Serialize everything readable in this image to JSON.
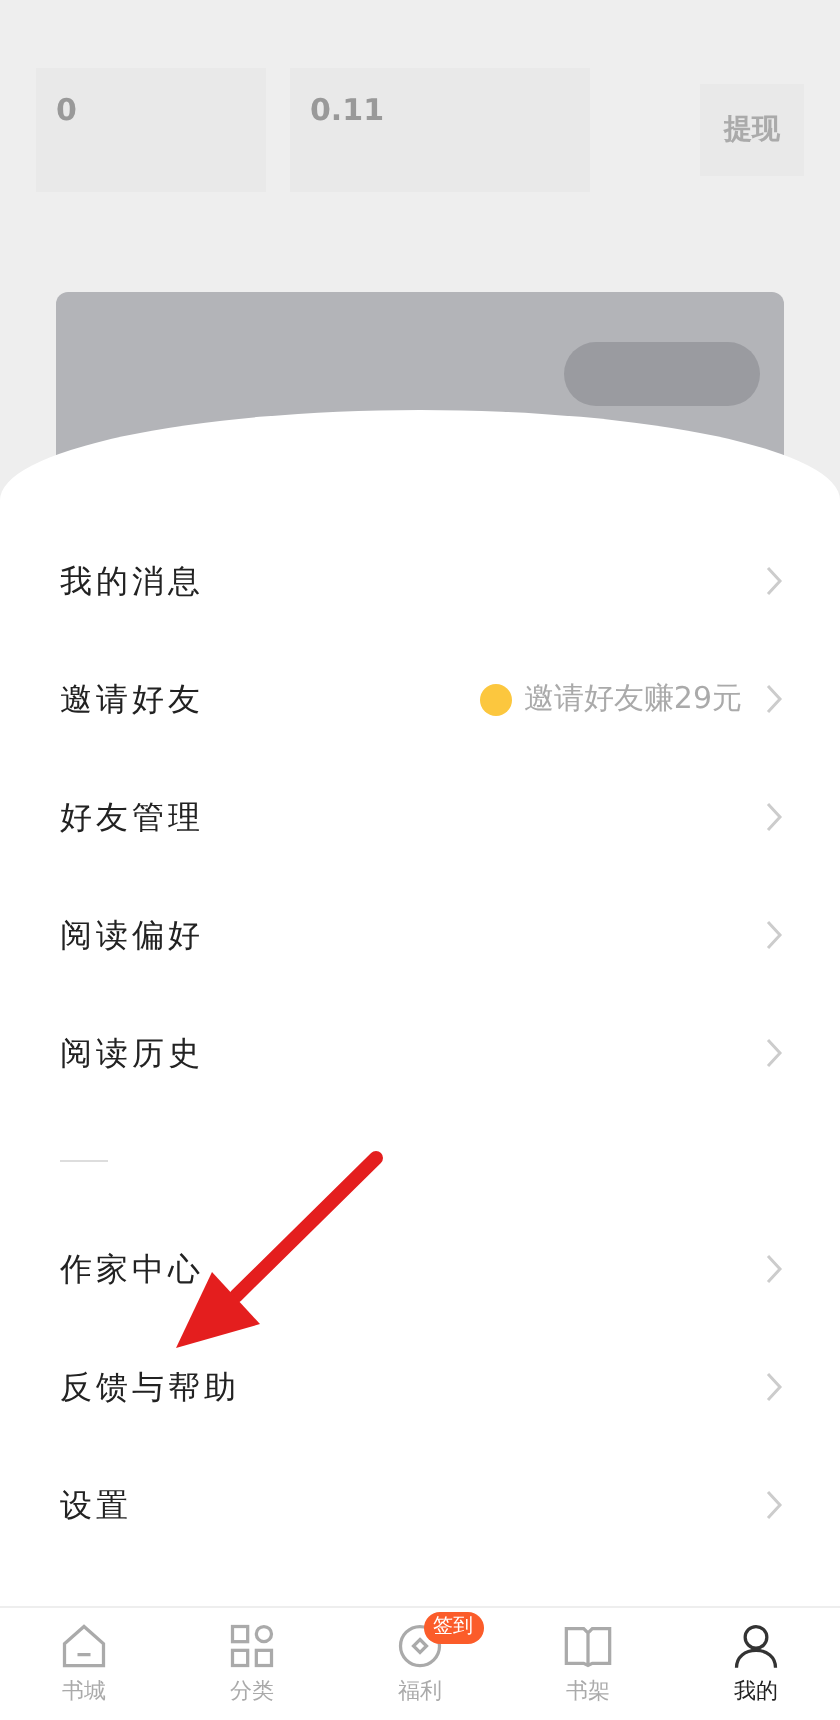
{
  "header": {
    "coins": "0",
    "cash": "0.11",
    "withdraw": "提现"
  },
  "menu_groups": [
    {
      "items": [
        {
          "label": "我的消息"
        },
        {
          "label": "邀请好友",
          "hint": "邀请好友赚29元"
        },
        {
          "label": "好友管理"
        },
        {
          "label": "阅读偏好"
        },
        {
          "label": "阅读历史"
        }
      ]
    },
    {
      "items": [
        {
          "label": "作家中心"
        },
        {
          "label": "反馈与帮助"
        },
        {
          "label": "设置"
        }
      ]
    }
  ],
  "tab_bar": [
    {
      "label": "书城",
      "selected": false
    },
    {
      "label": "分类",
      "selected": false
    },
    {
      "label": "福利",
      "selected": false,
      "badge": "签到"
    },
    {
      "label": "书架",
      "selected": false
    },
    {
      "label": "我的",
      "selected": true
    }
  ]
}
